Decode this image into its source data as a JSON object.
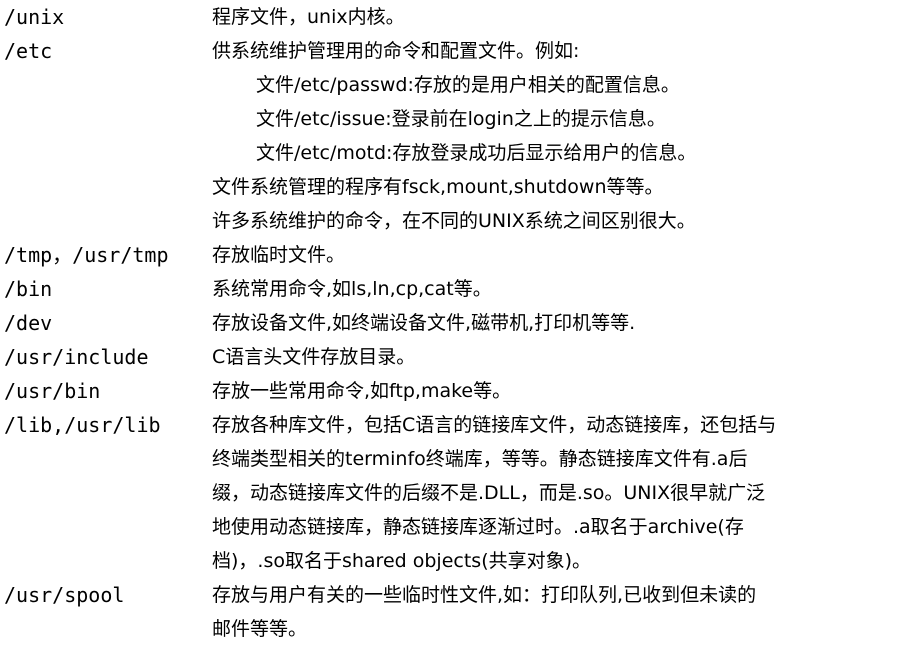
{
  "entries": [
    {
      "path": "/unix",
      "lines": [
        "程序文件，unix内核。"
      ]
    },
    {
      "path": "/etc",
      "lines": [
        "供系统维护管理用的命令和配置文件。例如:",
        "文件/etc/passwd:存放的是用户相关的配置信息。",
        "文件/etc/issue:登录前在login之上的提示信息。",
        "文件/etc/motd:存放登录成功后显示给用户的信息。",
        "文件系统管理的程序有fsck,mount,shutdown等等。",
        "许多系统维护的命令，在不同的UNIX系统之间区别很大。"
      ]
    },
    {
      "path": "/tmp，/usr/tmp",
      "lines": [
        "存放临时文件。"
      ]
    },
    {
      "path": "/bin",
      "lines": [
        "系统常用命令,如ls,ln,cp,cat等。"
      ]
    },
    {
      "path": "/dev",
      "lines": [
        "存放设备文件,如终端设备文件,磁带机,打印机等等."
      ]
    },
    {
      "path": "/usr/include",
      "lines": [
        "C语言头文件存放目录。"
      ]
    },
    {
      "path": "/usr/bin",
      "lines": [
        "存放一些常用命令,如ftp,make等。"
      ]
    },
    {
      "path": "/lib,/usr/lib",
      "lines": [
        "存放各种库文件，包括C语言的链接库文件，动态链接库，还包括与",
        "终端类型相关的terminfo终端库，等等。静态链接库文件有.a后",
        "缀，动态链接库文件的后缀不是.DLL，而是.so。UNIX很早就广泛",
        "地使用动态链接库，静态链接库逐渐过时。.a取名于archive(存",
        "档)，.so取名于shared objects(共享对象)。"
      ]
    },
    {
      "path": "/usr/spool",
      "lines": [
        "存放与用户有关的一些临时性文件,如：打印队列,已收到但未读的",
        "邮件等等。"
      ]
    }
  ]
}
